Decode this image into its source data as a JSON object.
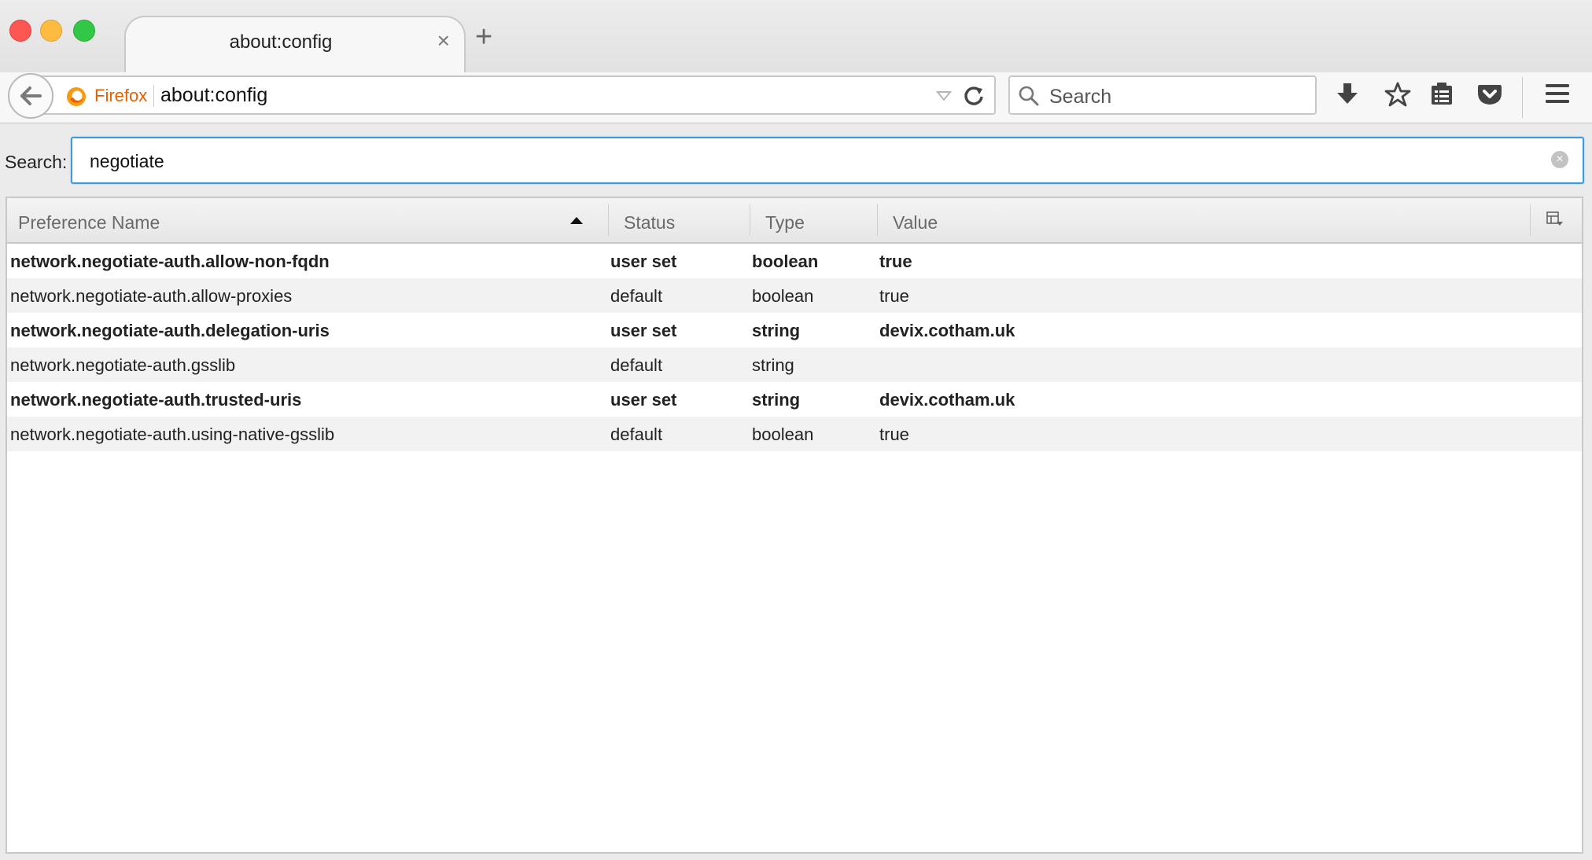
{
  "window": {
    "tab_title": "about:config",
    "tab_close_glyph": "×",
    "new_tab_glyph": "+"
  },
  "navbar": {
    "identity_label": "Firefox",
    "url": "about:config",
    "search_placeholder": "Search",
    "icons": [
      "back-arrow-icon",
      "firefox-icon",
      "dropdown-icon",
      "reload-icon",
      "search-icon",
      "download-icon",
      "bookmark-star-icon",
      "reading-list-icon",
      "pocket-icon",
      "menu-icon"
    ]
  },
  "config": {
    "search_label": "Search:",
    "filter_value": "negotiate",
    "columns": {
      "name": "Preference Name",
      "status": "Status",
      "type": "Type",
      "value": "Value"
    },
    "sort": {
      "column": "name",
      "direction": "ascending"
    },
    "rows": [
      {
        "name": "network.negotiate-auth.allow-non-fqdn",
        "status": "user set",
        "type": "boolean",
        "value": "true"
      },
      {
        "name": "network.negotiate-auth.allow-proxies",
        "status": "default",
        "type": "boolean",
        "value": "true"
      },
      {
        "name": "network.negotiate-auth.delegation-uris",
        "status": "user set",
        "type": "string",
        "value": "devix.cotham.uk"
      },
      {
        "name": "network.negotiate-auth.gsslib",
        "status": "default",
        "type": "string",
        "value": ""
      },
      {
        "name": "network.negotiate-auth.trusted-uris",
        "status": "user set",
        "type": "string",
        "value": "devix.cotham.uk"
      },
      {
        "name": "network.negotiate-auth.using-native-gsslib",
        "status": "default",
        "type": "boolean",
        "value": "true"
      }
    ]
  },
  "colors": {
    "accent": "#3d9bd9",
    "identity": "#e66000",
    "close": "#fc5753",
    "minimize": "#fdbc40",
    "maximize": "#33c748"
  }
}
